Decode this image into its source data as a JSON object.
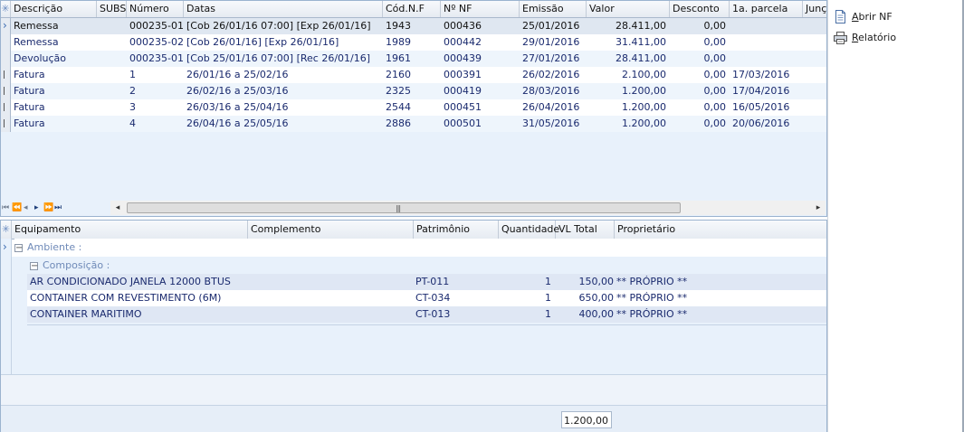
{
  "top_grid": {
    "columns": [
      "Descrição",
      "SUBS.",
      "Número",
      "Datas",
      "Cód.N.F",
      "Nº NF",
      "Emissão",
      "Valor",
      "Desconto",
      "1a. parcela",
      "Junção"
    ],
    "rows": [
      {
        "descricao": "Remessa",
        "subs": "",
        "numero": "000235-01",
        "datas": "[Cob 26/01/16 07:00]  [Exp 26/01/16]",
        "cod_nf": "1943",
        "n_nf": "000436",
        "emissao": "25/01/2016",
        "valor": "28.411,00",
        "desconto": "0,00",
        "parcela": "",
        "juncao": ""
      },
      {
        "descricao": "Remessa",
        "subs": "",
        "numero": "000235-02",
        "datas": "[Cob 26/01/16]  [Exp 26/01/16]",
        "cod_nf": "1989",
        "n_nf": "000442",
        "emissao": "29/01/2016",
        "valor": "31.411,00",
        "desconto": "0,00",
        "parcela": "",
        "juncao": ""
      },
      {
        "descricao": "Devolução",
        "subs": "",
        "numero": "000235-01",
        "datas": "[Cob 25/01/16 07:00]  [Rec 26/01/16]",
        "cod_nf": "1961",
        "n_nf": "000439",
        "emissao": "27/01/2016",
        "valor": "28.411,00",
        "desconto": "0,00",
        "parcela": "",
        "juncao": ""
      },
      {
        "descricao": "Fatura",
        "subs": "",
        "numero": "1",
        "datas": "26/01/16 a 25/02/16",
        "cod_nf": "2160",
        "n_nf": "000391",
        "emissao": "26/02/2016",
        "valor": "2.100,00",
        "desconto": "0,00",
        "parcela": "17/03/2016",
        "juncao": ""
      },
      {
        "descricao": "Fatura",
        "subs": "",
        "numero": "2",
        "datas": "26/02/16 a 25/03/16",
        "cod_nf": "2325",
        "n_nf": "000419",
        "emissao": "28/03/2016",
        "valor": "1.200,00",
        "desconto": "0,00",
        "parcela": "17/04/2016",
        "juncao": ""
      },
      {
        "descricao": "Fatura",
        "subs": "",
        "numero": "3",
        "datas": "26/03/16 a 25/04/16",
        "cod_nf": "2544",
        "n_nf": "000451",
        "emissao": "26/04/2016",
        "valor": "1.200,00",
        "desconto": "0,00",
        "parcela": "16/05/2016",
        "juncao": ""
      },
      {
        "descricao": "Fatura",
        "subs": "",
        "numero": "4",
        "datas": "26/04/16 a 25/05/16",
        "cod_nf": "2886",
        "n_nf": "000501",
        "emissao": "31/05/2016",
        "valor": "1.200,00",
        "desconto": "0,00",
        "parcela": "20/06/2016",
        "juncao": ""
      }
    ],
    "nav": {
      "first": "⏮",
      "prev_page": "⏪",
      "prev": "◂",
      "next": "▸",
      "next_page": "⏩",
      "last": "⏭"
    },
    "scroll": {
      "left": "◂",
      "right": "▸",
      "grip": "|||"
    }
  },
  "bottom_grid": {
    "columns": [
      "Equipamento",
      "Complemento",
      "Patrimônio",
      "Quantidade",
      "VL Total",
      "Proprietário"
    ],
    "group_ambiente": "Ambiente :",
    "group_composicao": "Composição :",
    "items": [
      {
        "equipamento": "AR CONDICIONADO JANELA 12000 BTUS",
        "complemento": "",
        "patrimonio": "PT-011",
        "quantidade": "1",
        "vl_total": "150,00",
        "proprietario": "** PRÓPRIO **"
      },
      {
        "equipamento": "CONTAINER COM REVESTIMENTO (6M)",
        "complemento": "",
        "patrimonio": "CT-034",
        "quantidade": "1",
        "vl_total": "650,00",
        "proprietario": "** PRÓPRIO **"
      },
      {
        "equipamento": "CONTAINER MARITIMO",
        "complemento": "",
        "patrimonio": "CT-013",
        "quantidade": "1",
        "vl_total": "400,00",
        "proprietario": "** PRÓPRIO **"
      }
    ],
    "total": "1.200,00"
  },
  "actions": {
    "abrir_nf_prefix": "A",
    "abrir_nf_rest": "brir NF",
    "relatorio_prefix": "R",
    "relatorio_rest": "elatório"
  },
  "icons": {
    "abrir_nf": "document-icon",
    "relatorio": "printer-icon"
  }
}
